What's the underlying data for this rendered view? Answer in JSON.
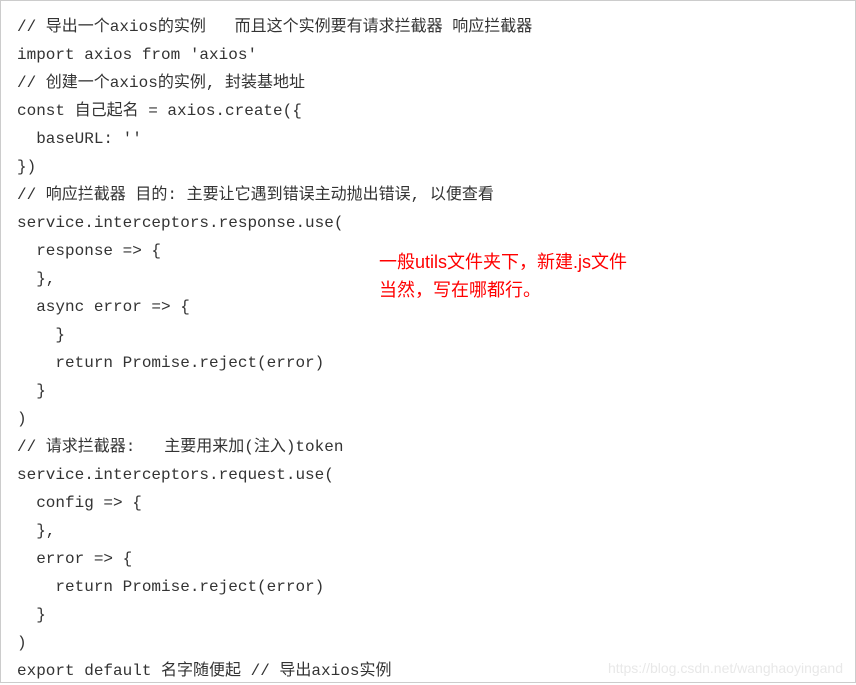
{
  "code": {
    "line1": "// 导出一个axios的实例   而且这个实例要有请求拦截器 响应拦截器",
    "line2": "import axios from 'axios'",
    "line3": "// 创建一个axios的实例, 封装基地址",
    "line4": "const 自己起名 = axios.create({",
    "line5": "  baseURL: ''",
    "line6": "})",
    "line7": "// 响应拦截器 目的: 主要让它遇到错误主动抛出错误, 以便查看",
    "line8": "service.interceptors.response.use(",
    "line9": "  response => {",
    "line10": "  },",
    "line11": "  async error => {",
    "line12": "    }",
    "line13": "    return Promise.reject(error)",
    "line14": "  }",
    "line15": ")",
    "line16": "// 请求拦截器:   主要用来加(注入)token",
    "line17": "service.interceptors.request.use(",
    "line18": "  config => {",
    "line19": "  },",
    "line20": "  error => {",
    "line21": "    return Promise.reject(error)",
    "line22": "  }",
    "line23": ")",
    "line24": "export default 名字随便起 // 导出axios实例"
  },
  "annotations": {
    "note1": "一般utils文件夹下，新建.js文件",
    "note2": "当然，写在哪都行。"
  },
  "watermark": "https://blog.csdn.net/wanghaoyingand"
}
